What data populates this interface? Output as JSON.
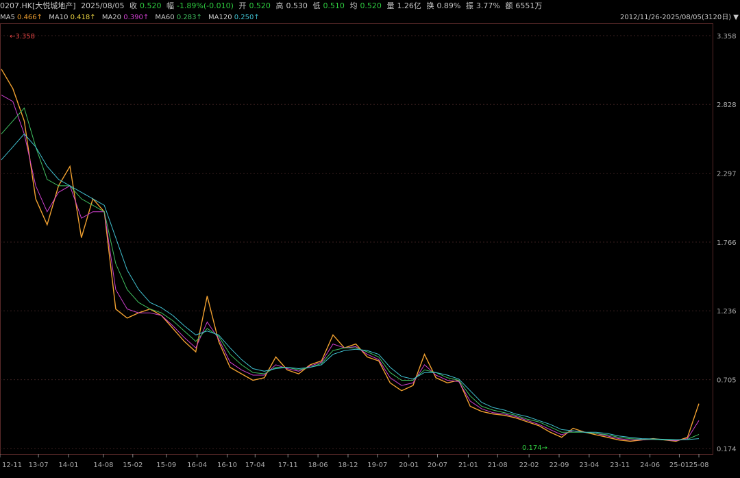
{
  "header": {
    "code": "0207.HK[大悦城地产]",
    "date": "2025/08/05",
    "close_label": "收",
    "close": "0.520",
    "change_label": "幅",
    "change": "-1.89%(-0.010)",
    "open_label": "开",
    "open": "0.520",
    "high_label": "高",
    "high": "0.530",
    "low_label": "低",
    "low": "0.510",
    "avg_label": "均",
    "avg": "0.520",
    "vol_label": "量",
    "vol": "1.26亿",
    "turn_label": "换",
    "turn": "0.89%",
    "amp_label": "振",
    "amp": "3.77%",
    "amt_label": "额",
    "amt": "6551万"
  },
  "ma_bar": {
    "ma5_label": "MA5",
    "ma5": "0.466↑",
    "ma10_label": "MA10",
    "ma10": "0.418↑",
    "ma20_label": "MA20",
    "ma20": "0.390↑",
    "ma60_label": "MA60",
    "ma60": "0.283↑",
    "ma120_label": "MA120",
    "ma120": "0.250↑",
    "range": "2012/11/26-2025/08/05(3120日)",
    "range_icon": "triangle-down-icon"
  },
  "colors": {
    "ma5": "#f0a030",
    "ma10": "#e8d040",
    "ma20": "#d040d0",
    "ma60": "#40c060",
    "ma120": "#40c0d0",
    "up": "#e64545",
    "down": "#2ecc40",
    "grid": "#3a2020",
    "axis": "#aaaaaa"
  },
  "chart_data": {
    "type": "line",
    "y_ticks": [
      "3.358",
      "2.828",
      "2.297",
      "1.766",
      "1.236",
      "0.705",
      "0.174"
    ],
    "ylim": [
      0.174,
      3.358
    ],
    "x_ticks": [
      "12-11",
      "13-07",
      "14-01",
      "14-08",
      "15-02",
      "15-09",
      "16-04",
      "16-10",
      "17-04",
      "17-11",
      "18-06",
      "18-12",
      "19-07",
      "20-01",
      "20-07",
      "21-01",
      "21-08",
      "22-02",
      "22-09",
      "23-04",
      "23-11",
      "24-06",
      "25-01",
      "25-08"
    ],
    "x_tick_t": [
      0,
      0.055,
      0.098,
      0.148,
      0.19,
      0.238,
      0.282,
      0.325,
      0.365,
      0.412,
      0.455,
      0.498,
      0.54,
      0.585,
      0.626,
      0.67,
      0.712,
      0.757,
      0.8,
      0.843,
      0.887,
      0.93,
      0.972,
      1.0
    ],
    "max_annotation": "3.358",
    "min_annotation": "0.174",
    "series": [
      {
        "key": "close",
        "values": [
          3.1,
          2.95,
          2.7,
          2.1,
          1.9,
          2.2,
          2.35,
          1.8,
          2.1,
          2.0,
          1.25,
          1.18,
          1.22,
          1.25,
          1.2,
          1.1,
          1.0,
          0.92,
          1.35,
          1.0,
          0.8,
          0.75,
          0.7,
          0.72,
          0.88,
          0.78,
          0.75,
          0.82,
          0.85,
          1.05,
          0.95,
          0.98,
          0.88,
          0.85,
          0.68,
          0.62,
          0.66,
          0.9,
          0.72,
          0.68,
          0.7,
          0.5,
          0.46,
          0.44,
          0.43,
          0.41,
          0.38,
          0.35,
          0.3,
          0.26,
          0.33,
          0.3,
          0.28,
          0.26,
          0.24,
          0.23,
          0.24,
          0.25,
          0.24,
          0.23,
          0.26,
          0.52
        ]
      },
      {
        "key": "ma20",
        "values": [
          2.9,
          2.85,
          2.6,
          2.2,
          2.0,
          2.15,
          2.2,
          1.95,
          2.0,
          2.0,
          1.4,
          1.25,
          1.22,
          1.22,
          1.2,
          1.12,
          1.03,
          0.95,
          1.15,
          1.02,
          0.84,
          0.78,
          0.74,
          0.74,
          0.82,
          0.79,
          0.77,
          0.81,
          0.84,
          0.98,
          0.95,
          0.96,
          0.9,
          0.86,
          0.72,
          0.66,
          0.68,
          0.82,
          0.74,
          0.7,
          0.69,
          0.54,
          0.48,
          0.45,
          0.44,
          0.42,
          0.39,
          0.36,
          0.32,
          0.28,
          0.31,
          0.3,
          0.29,
          0.27,
          0.25,
          0.24,
          0.24,
          0.245,
          0.24,
          0.235,
          0.25,
          0.39
        ]
      },
      {
        "key": "ma60",
        "values": [
          2.6,
          2.7,
          2.8,
          2.5,
          2.25,
          2.2,
          2.2,
          2.1,
          2.05,
          2.0,
          1.6,
          1.4,
          1.3,
          1.25,
          1.22,
          1.16,
          1.08,
          1.0,
          1.1,
          1.04,
          0.9,
          0.82,
          0.76,
          0.75,
          0.8,
          0.8,
          0.78,
          0.8,
          0.83,
          0.93,
          0.95,
          0.95,
          0.92,
          0.88,
          0.76,
          0.7,
          0.7,
          0.78,
          0.76,
          0.72,
          0.7,
          0.58,
          0.5,
          0.47,
          0.45,
          0.43,
          0.4,
          0.38,
          0.34,
          0.3,
          0.3,
          0.3,
          0.29,
          0.28,
          0.26,
          0.25,
          0.245,
          0.245,
          0.24,
          0.24,
          0.245,
          0.283
        ]
      },
      {
        "key": "ma120",
        "values": [
          2.4,
          2.5,
          2.6,
          2.5,
          2.35,
          2.25,
          2.2,
          2.15,
          2.1,
          2.05,
          1.8,
          1.55,
          1.4,
          1.3,
          1.26,
          1.2,
          1.12,
          1.05,
          1.08,
          1.05,
          0.95,
          0.86,
          0.79,
          0.77,
          0.79,
          0.8,
          0.79,
          0.8,
          0.82,
          0.9,
          0.93,
          0.94,
          0.93,
          0.9,
          0.8,
          0.73,
          0.71,
          0.76,
          0.76,
          0.74,
          0.71,
          0.62,
          0.53,
          0.49,
          0.47,
          0.44,
          0.42,
          0.39,
          0.36,
          0.32,
          0.31,
          0.3,
          0.3,
          0.29,
          0.27,
          0.26,
          0.25,
          0.248,
          0.245,
          0.242,
          0.243,
          0.25
        ]
      }
    ]
  }
}
